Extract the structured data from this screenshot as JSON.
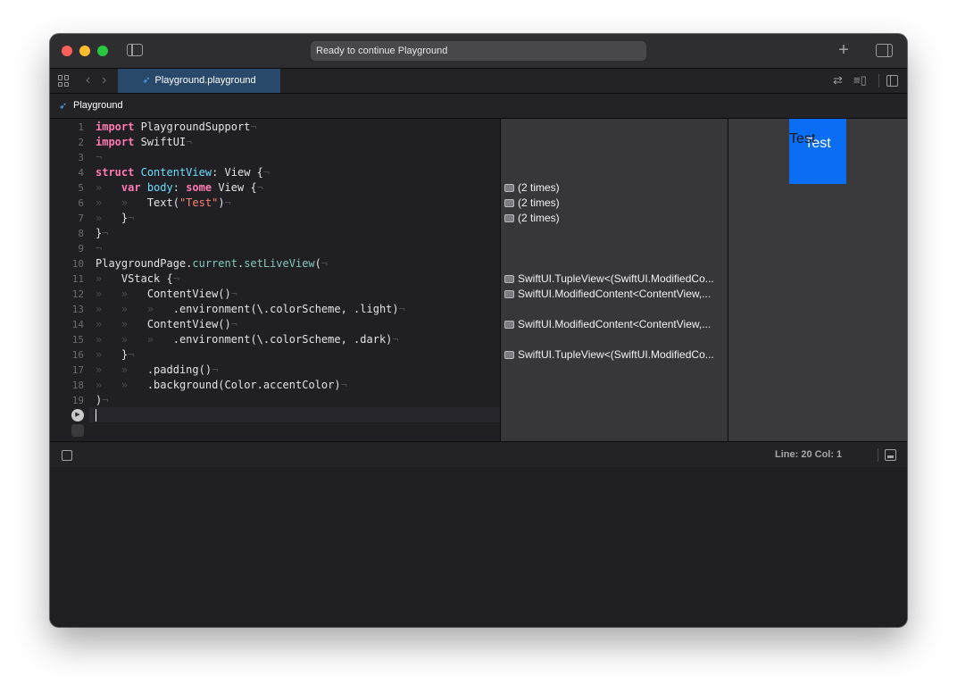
{
  "window": {
    "status_text": "Ready to continue Playground",
    "plus_label": "+"
  },
  "tabbar": {
    "active_tab_label": "Playground.playground",
    "back_glyph": "‹",
    "forward_glyph": "›",
    "swap_glyph": "⇄",
    "minimap_glyph": "≡▯"
  },
  "jumpbar": {
    "item_label": "Playground"
  },
  "editor": {
    "line_numbers": [
      "1",
      "2",
      "3",
      "4",
      "5",
      "6",
      "7",
      "8",
      "9",
      "10",
      "11",
      "12",
      "13",
      "14",
      "15",
      "16",
      "17",
      "18",
      "19"
    ],
    "current_line": "20",
    "run_glyph": "▶"
  },
  "results": [
    {
      "line": 5,
      "text": "(2 times)"
    },
    {
      "line": 6,
      "text": "(2 times)"
    },
    {
      "line": 7,
      "text": "(2 times)"
    },
    {
      "line": 11,
      "text": "SwiftUI.TupleView<(SwiftUI.ModifiedCo..."
    },
    {
      "line": 12,
      "text": "SwiftUI.ModifiedContent<ContentView,..."
    },
    {
      "line": 14,
      "text": "SwiftUI.ModifiedContent<ContentView,..."
    },
    {
      "line": 16,
      "text": "SwiftUI.TupleView<(SwiftUI.ModifiedCo..."
    }
  ],
  "live_view": {
    "text_light": "Test",
    "text_dark": "Test",
    "background_color": "#0a6ef5"
  },
  "statusbar": {
    "line_col": "Line: 20  Col: 1"
  },
  "colors": {
    "keyword": "#ff7ab2",
    "type": "#6bdfff",
    "string": "#ff8170",
    "accent_tab": "#29496a"
  },
  "icons": [
    "sidebar-toggle-icon",
    "plus-icon",
    "inspector-toggle-icon",
    "grid-icon",
    "swift-icon",
    "swap-icon",
    "minimap-icon",
    "add-editor-icon",
    "run-icon",
    "console-toggle-icon",
    "panel-toggle-icon"
  ]
}
